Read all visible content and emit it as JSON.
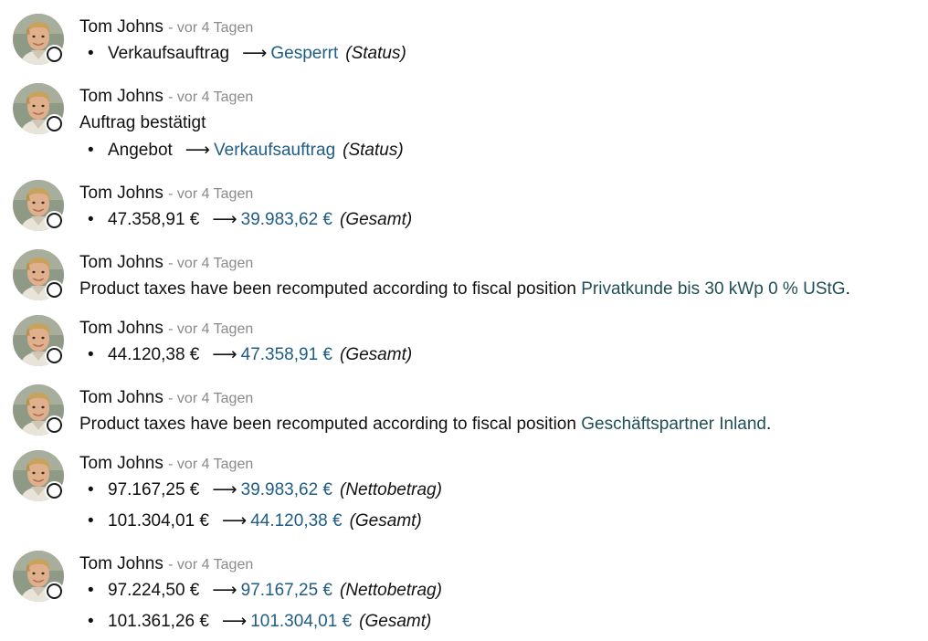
{
  "messages": [
    {
      "author": "Tom Johns",
      "date": "- vor 4 Tagen",
      "body": "",
      "tracking": [
        {
          "old": "Verkaufsauftrag",
          "new": "Gesperrt",
          "field": "(Status)"
        }
      ]
    },
    {
      "author": "Tom Johns",
      "date": "- vor 4 Tagen",
      "body": "Auftrag bestätigt",
      "tracking": [
        {
          "old": "Angebot",
          "new": "Verkaufsauftrag",
          "field": "(Status)"
        }
      ]
    },
    {
      "author": "Tom Johns",
      "date": "- vor 4 Tagen",
      "body": "",
      "tracking": [
        {
          "old": "47.358,91 €",
          "new": "39.983,62 €",
          "field": "(Gesamt)"
        }
      ]
    },
    {
      "author": "Tom Johns",
      "date": "- vor 4 Tagen",
      "body": "Product taxes have been recomputed according to fiscal position",
      "link": "Privatkunde bis 30 kWp 0 % UStG",
      "tracking": []
    },
    {
      "author": "Tom Johns",
      "date": "- vor 4 Tagen",
      "body": "",
      "tracking": [
        {
          "old": "44.120,38 €",
          "new": "47.358,91 €",
          "field": "(Gesamt)"
        }
      ]
    },
    {
      "author": "Tom Johns",
      "date": "- vor 4 Tagen",
      "body": "Product taxes have been recomputed according to fiscal position",
      "link": "Geschäftspartner Inland",
      "tracking": []
    },
    {
      "author": "Tom Johns",
      "date": "- vor 4 Tagen",
      "body": "",
      "tracking": [
        {
          "old": "97.167,25 €",
          "new": "39.983,62 €",
          "field": "(Nettobetrag)"
        },
        {
          "old": "101.304,01 €",
          "new": "44.120,38 €",
          "field": "(Gesamt)"
        }
      ]
    },
    {
      "author": "Tom Johns",
      "date": "- vor 4 Tagen",
      "body": "",
      "tracking": [
        {
          "old": "97.224,50 €",
          "new": "97.167,25 €",
          "field": "(Nettobetrag)"
        },
        {
          "old": "101.361,26 €",
          "new": "101.304,01 €",
          "field": "(Gesamt)"
        }
      ]
    }
  ],
  "symbols": {
    "arrow": "⟶",
    "bullet": "•",
    "period": "."
  },
  "colors": {
    "new_value": "#1f5c86",
    "record_link": "#1f4f55",
    "date": "#8a8a8a"
  },
  "icons": {
    "avatar": "user-avatar",
    "presence": "presence-status-icon"
  }
}
